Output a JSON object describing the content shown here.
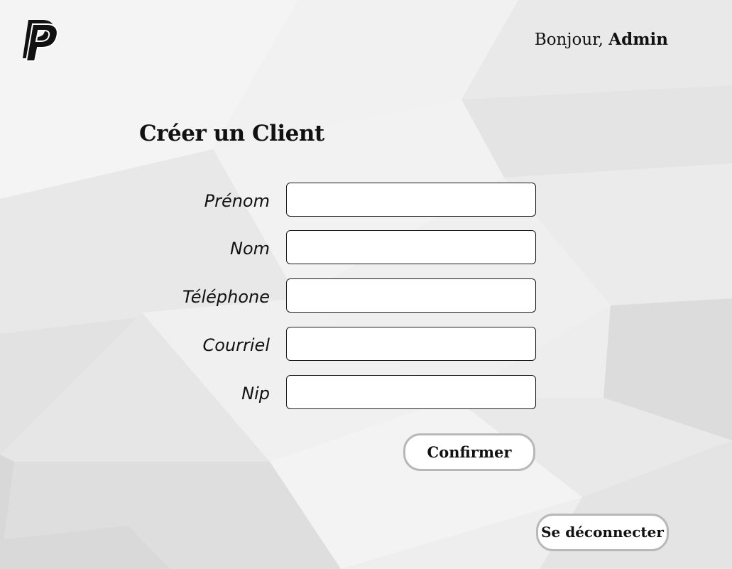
{
  "header": {
    "logo_name": "paypal-logo-icon",
    "greeting_prefix": "Bonjour,",
    "user_name": "Admin"
  },
  "form": {
    "title": "Créer un Client",
    "fields": [
      {
        "label": "Prénom",
        "value": "",
        "placeholder": ""
      },
      {
        "label": "Nom",
        "value": "",
        "placeholder": ""
      },
      {
        "label": "Téléphone",
        "value": "",
        "placeholder": ""
      },
      {
        "label": "Courriel",
        "value": "",
        "placeholder": ""
      },
      {
        "label": "Nip",
        "value": "",
        "placeholder": ""
      }
    ],
    "confirm_label": "Confirmer"
  },
  "footer": {
    "logout_label": "Se déconnecter"
  },
  "colors": {
    "background": "#ececec",
    "input_border": "#1a1a1a",
    "button_border": "#b8b8b8",
    "text": "#111111"
  }
}
